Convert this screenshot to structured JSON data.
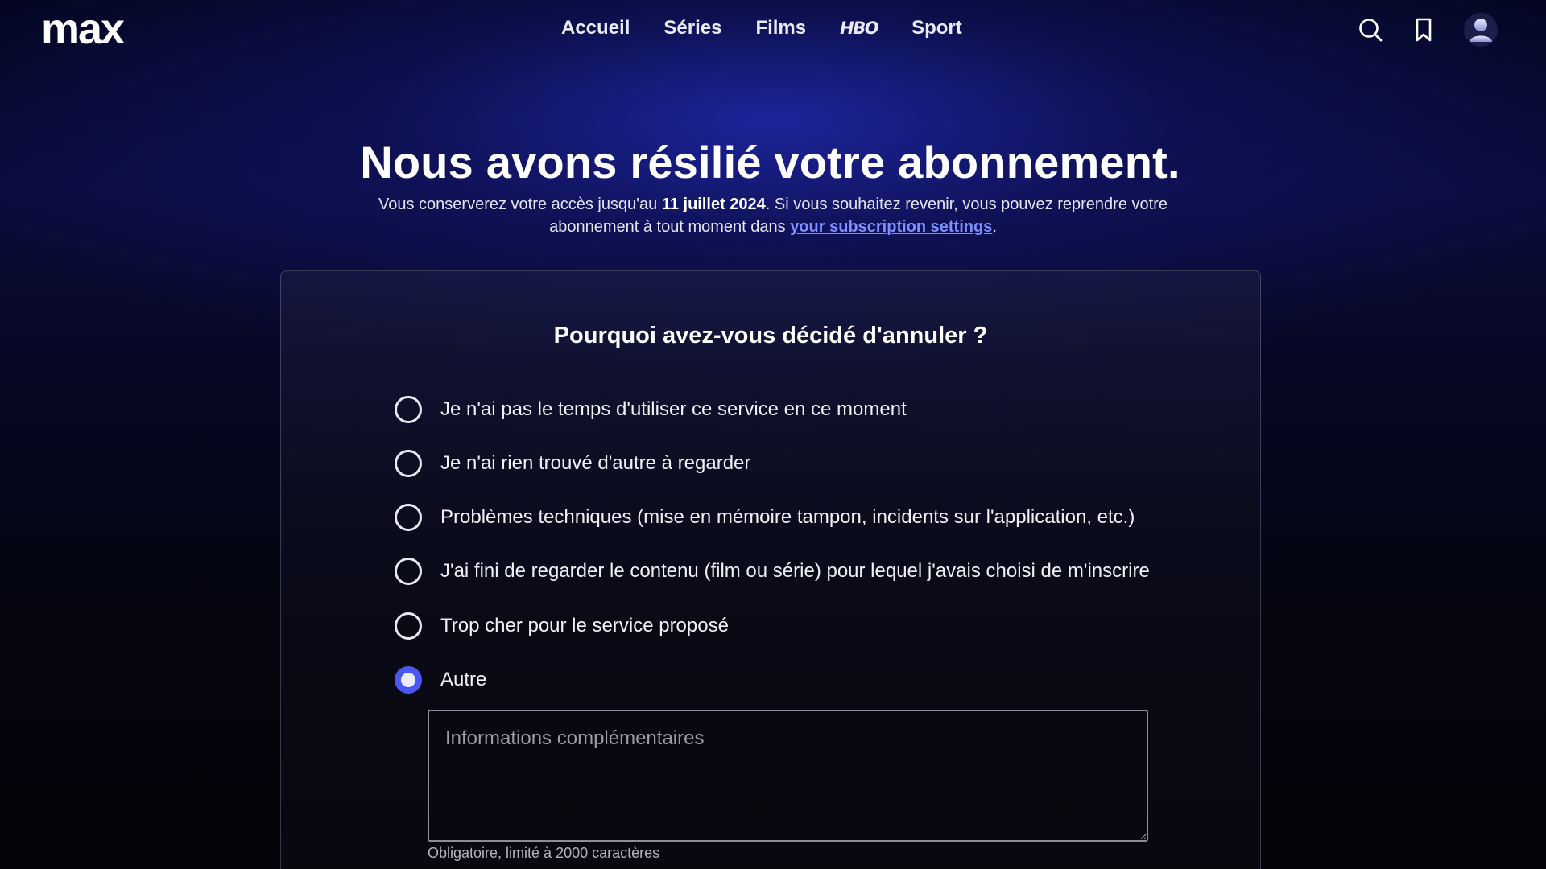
{
  "brand": {
    "logo": "max"
  },
  "nav": {
    "items": [
      {
        "label": "Accueil"
      },
      {
        "label": "Séries"
      },
      {
        "label": "Films"
      },
      {
        "label": "HBO"
      },
      {
        "label": "Sport"
      }
    ]
  },
  "header_icons": [
    "search-icon",
    "bookmark-icon",
    "avatar"
  ],
  "hero": {
    "title": "Nous avons résilié votre abonnement.",
    "subtitle_part1": "Vous conserverez votre accès jusqu'au ",
    "access_date": "11 juillet 2024",
    "subtitle_part2": ". Si vous souhaitez revenir, vous pouvez reprendre votre abonnement à tout moment dans ",
    "settings_link": "your subscription settings",
    "subtitle_end": "."
  },
  "survey": {
    "question": "Pourquoi avez-vous décidé d'annuler ?",
    "options": [
      {
        "label": "Je n'ai pas le temps d'utiliser ce service en ce moment",
        "selected": false
      },
      {
        "label": "Je n'ai rien trouvé d'autre à regarder",
        "selected": false
      },
      {
        "label": "Problèmes techniques (mise en mémoire tampon, incidents sur l'application, etc.)",
        "selected": false
      },
      {
        "label": "J'ai fini de regarder le contenu (film ou série) pour lequel j'avais choisi de m'inscrire",
        "selected": false
      },
      {
        "label": "Trop cher pour le service proposé",
        "selected": false
      },
      {
        "label": "Autre",
        "selected": true
      }
    ],
    "details_value": "",
    "details_placeholder": "Informations complémentaires",
    "details_hint": "Obligatoire, limité à 2000 caractères"
  },
  "colors": {
    "accent": "#4a57f0",
    "link": "#7f8eff",
    "background": "#04050f"
  }
}
